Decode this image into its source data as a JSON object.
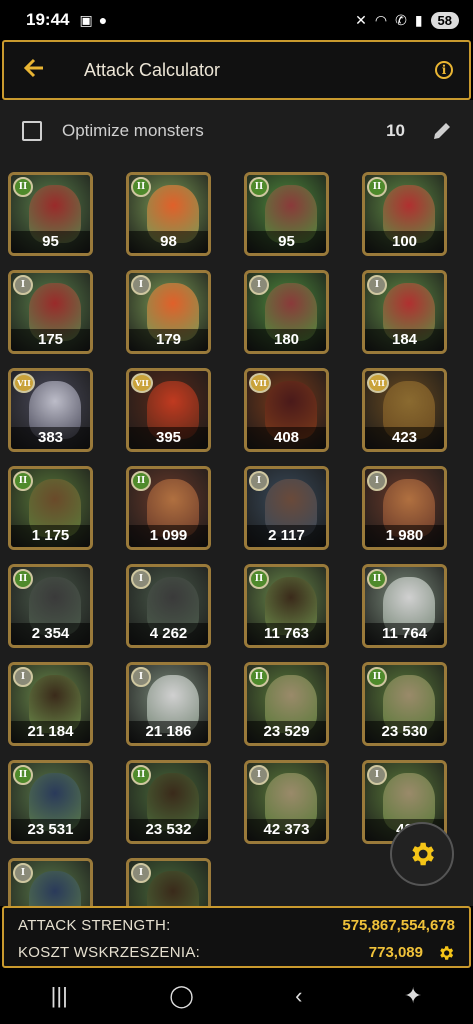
{
  "status": {
    "time": "19:44",
    "battery": "58"
  },
  "appbar": {
    "title": "Attack Calculator",
    "back_icon": "arrow-left-icon",
    "info_icon": "info-icon"
  },
  "options": {
    "optimize_label": "Optimize monsters",
    "count": "10"
  },
  "units": [
    {
      "value": "95",
      "badge": "II",
      "tier": "green",
      "art": "octopus-red"
    },
    {
      "value": "98",
      "badge": "II",
      "tier": "green",
      "art": "phoenix"
    },
    {
      "value": "95",
      "badge": "II",
      "tier": "green",
      "art": "serpent"
    },
    {
      "value": "100",
      "badge": "II",
      "tier": "green",
      "art": "ape-red"
    },
    {
      "value": "175",
      "badge": "I",
      "tier": "grey",
      "art": "octopus-red"
    },
    {
      "value": "179",
      "badge": "I",
      "tier": "grey",
      "art": "phoenix"
    },
    {
      "value": "180",
      "badge": "I",
      "tier": "grey",
      "art": "serpent"
    },
    {
      "value": "184",
      "badge": "I",
      "tier": "grey",
      "art": "ape-red"
    },
    {
      "value": "383",
      "badge": "VII",
      "tier": "gold",
      "art": "skull-demon"
    },
    {
      "value": "395",
      "badge": "VII",
      "tier": "gold",
      "art": "dragon-red"
    },
    {
      "value": "408",
      "badge": "VII",
      "tier": "gold",
      "art": "dark-knight"
    },
    {
      "value": "423",
      "badge": "VII",
      "tier": "gold",
      "art": "brown-beast"
    },
    {
      "value": "1 175",
      "badge": "II",
      "tier": "green",
      "art": "soldier-hat"
    },
    {
      "value": "1 099",
      "badge": "II",
      "tier": "green",
      "art": "lion-beast"
    },
    {
      "value": "2 117",
      "badge": "I",
      "tier": "grey",
      "art": "soldier-blue"
    },
    {
      "value": "1 980",
      "badge": "I",
      "tier": "grey",
      "art": "lion-beast"
    },
    {
      "value": "2 354",
      "badge": "II",
      "tier": "green",
      "art": "cannon"
    },
    {
      "value": "4 262",
      "badge": "I",
      "tier": "grey",
      "art": "cannon"
    },
    {
      "value": "11 763",
      "badge": "II",
      "tier": "green",
      "art": "musketeer"
    },
    {
      "value": "11 764",
      "badge": "II",
      "tier": "green",
      "art": "knight-horse"
    },
    {
      "value": "21 184",
      "badge": "I",
      "tier": "grey",
      "art": "musketeer"
    },
    {
      "value": "21 186",
      "badge": "I",
      "tier": "grey",
      "art": "knight-horse"
    },
    {
      "value": "23 529",
      "badge": "II",
      "tier": "green",
      "art": "gunner-helmet"
    },
    {
      "value": "23 530",
      "badge": "II",
      "tier": "green",
      "art": "gunner-helmet"
    },
    {
      "value": "23 531",
      "badge": "II",
      "tier": "green",
      "art": "cavalier-blue"
    },
    {
      "value": "23 532",
      "badge": "II",
      "tier": "green",
      "art": "hooded-man"
    },
    {
      "value": "42 373",
      "badge": "I",
      "tier": "grey",
      "art": "gunner-helmet"
    },
    {
      "value": "42",
      "badge": "I",
      "tier": "grey",
      "art": "gunner-helmet"
    },
    {
      "value": "",
      "badge": "I",
      "tier": "grey",
      "art": "cavalier-blue"
    },
    {
      "value": "",
      "badge": "I",
      "tier": "grey",
      "art": "hooded-man"
    }
  ],
  "footer": {
    "attack_label": "ATTACK STRENGTH:",
    "attack_value": "575,867,554,678",
    "revive_label": "KOSZT WSKRZESZENIA:",
    "revive_value": "773,089"
  },
  "colors": {
    "accent": "#e9b533",
    "border": "#c99a2e",
    "background": "#1d1d1d"
  },
  "nav": {
    "recent_icon": "recents-icon",
    "home_icon": "home-icon",
    "back_icon": "back-icon",
    "accessibility_icon": "accessibility-icon"
  }
}
